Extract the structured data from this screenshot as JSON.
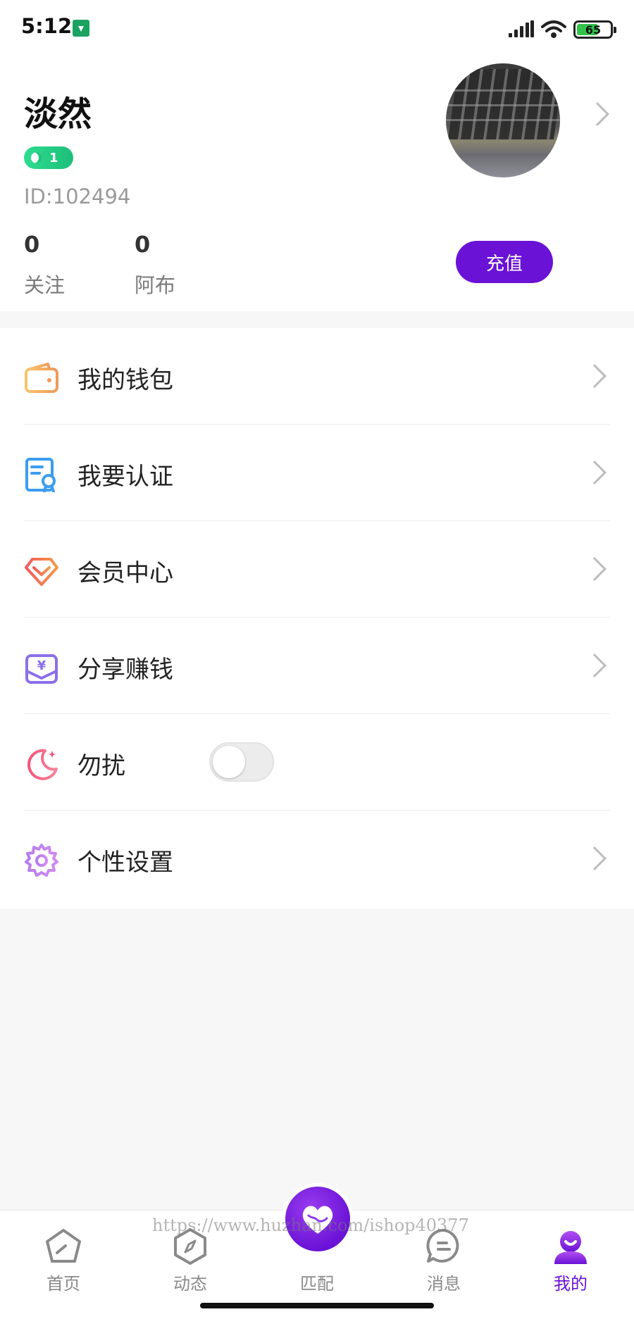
{
  "status_bar": {
    "time": "5:12",
    "battery": "65"
  },
  "profile": {
    "username": "淡然",
    "level": "1",
    "user_id": "ID:102494",
    "stats": [
      {
        "value": "0",
        "label": "关注"
      },
      {
        "value": "0",
        "label": "阿布"
      }
    ],
    "recharge_label": "充值"
  },
  "menu": {
    "items": [
      {
        "label": "我的钱包",
        "icon": "wallet-icon"
      },
      {
        "label": "我要认证",
        "icon": "certificate-icon"
      },
      {
        "label": "会员中心",
        "icon": "diamond-icon"
      },
      {
        "label": "分享赚钱",
        "icon": "yen-pouch-icon"
      },
      {
        "label": "勿扰",
        "icon": "moon-icon",
        "toggle_on": false
      },
      {
        "label": "个性设置",
        "icon": "gear-icon"
      }
    ]
  },
  "tabbar": {
    "items": [
      {
        "label": "首页",
        "icon": "home-icon"
      },
      {
        "label": "动态",
        "icon": "compass-icon"
      },
      {
        "label": "匹配",
        "icon": "heart-match-icon"
      },
      {
        "label": "消息",
        "icon": "chat-bubble-icon"
      },
      {
        "label": "我的",
        "icon": "profile-icon",
        "active": true
      }
    ]
  },
  "watermark": "https://www.huzhan.com/ishop40377",
  "colors": {
    "accent": "#6a12d6",
    "badge_green": "#1fc57c"
  }
}
